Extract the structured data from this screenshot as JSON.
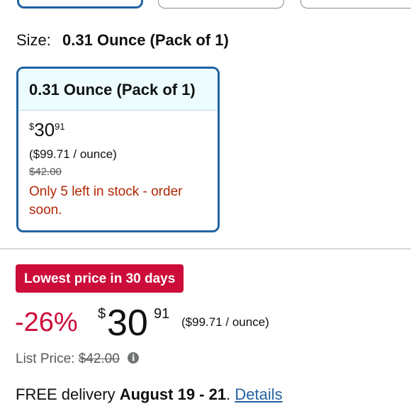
{
  "size_selector": {
    "label": "Size:",
    "selected_value": "0.31 Ounce (Pack of 1)"
  },
  "size_card": {
    "title": "0.31 Ounce (Pack of 1)",
    "price_symbol": "$",
    "price_whole": "30",
    "price_fraction": "91",
    "unit_price": "($99.71 / ounce)",
    "list_price": "$42.00",
    "stock_message": "Only 5 left in stock - order soon."
  },
  "deal": {
    "badge": "Lowest price in 30 days",
    "discount": "-26%",
    "price_symbol": "$",
    "price_whole": "30",
    "price_fraction": "91",
    "unit_price": "($99.71 / ounce)"
  },
  "list_price_row": {
    "label": "List Price:",
    "value": "$42.00",
    "info_icon": "i"
  },
  "delivery": {
    "prefix": "FREE delivery",
    "dates": "August 19 - 21",
    "separator": ".",
    "details_link": "Details"
  },
  "colors": {
    "selected_border": "#2162a1",
    "deal_red": "#cc0c39",
    "stock_red": "#b12704",
    "link_blue": "#2162a1"
  }
}
